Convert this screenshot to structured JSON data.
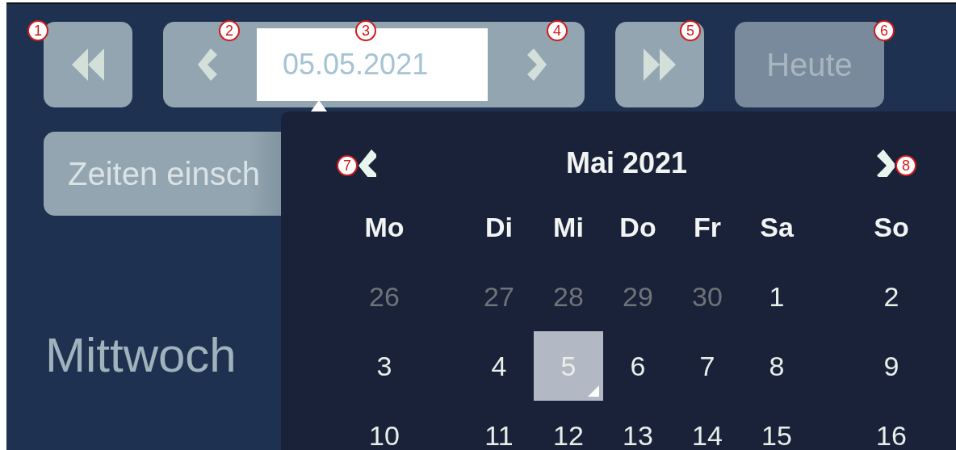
{
  "toolbar": [
    {
      "kind": "rewind"
    },
    {
      "kind": "stepper",
      "value": "05.05.2021"
    },
    {
      "kind": "forward"
    },
    {
      "kind": "text",
      "label": "Heute",
      "disabled": true
    }
  ],
  "times_button": {
    "label": "Zeiten einsch"
  },
  "day_name": "Mittwoch",
  "calendar": {
    "title": "Mai 2021",
    "weekdays": [
      "Mo",
      "Di",
      "Mi",
      "Do",
      "Fr",
      "Sa",
      "So"
    ],
    "weeks": [
      [
        {
          "day": "26",
          "outside": true,
          "selected": false
        },
        {
          "day": "27",
          "outside": true,
          "selected": false
        },
        {
          "day": "28",
          "outside": true,
          "selected": false
        },
        {
          "day": "29",
          "outside": true,
          "selected": false
        },
        {
          "day": "30",
          "outside": true,
          "selected": false
        },
        {
          "day": "1",
          "outside": false,
          "selected": false
        },
        {
          "day": "2",
          "outside": false,
          "selected": false
        }
      ],
      [
        {
          "day": "3",
          "outside": false,
          "selected": false
        },
        {
          "day": "4",
          "outside": false,
          "selected": false
        },
        {
          "day": "5",
          "outside": false,
          "selected": true
        },
        {
          "day": "6",
          "outside": false,
          "selected": false
        },
        {
          "day": "7",
          "outside": false,
          "selected": false
        },
        {
          "day": "8",
          "outside": false,
          "selected": false
        },
        {
          "day": "9",
          "outside": false,
          "selected": false
        }
      ],
      [
        {
          "day": "10",
          "outside": false,
          "selected": false
        },
        {
          "day": "11",
          "outside": false,
          "selected": false
        },
        {
          "day": "12",
          "outside": false,
          "selected": false
        },
        {
          "day": "13",
          "outside": false,
          "selected": false
        },
        {
          "day": "14",
          "outside": false,
          "selected": false
        },
        {
          "day": "15",
          "outside": false,
          "selected": false
        },
        {
          "day": "16",
          "outside": false,
          "selected": false
        }
      ]
    ]
  },
  "markers": [
    "1",
    "2",
    "3",
    "4",
    "5",
    "6",
    "7",
    "8"
  ]
}
